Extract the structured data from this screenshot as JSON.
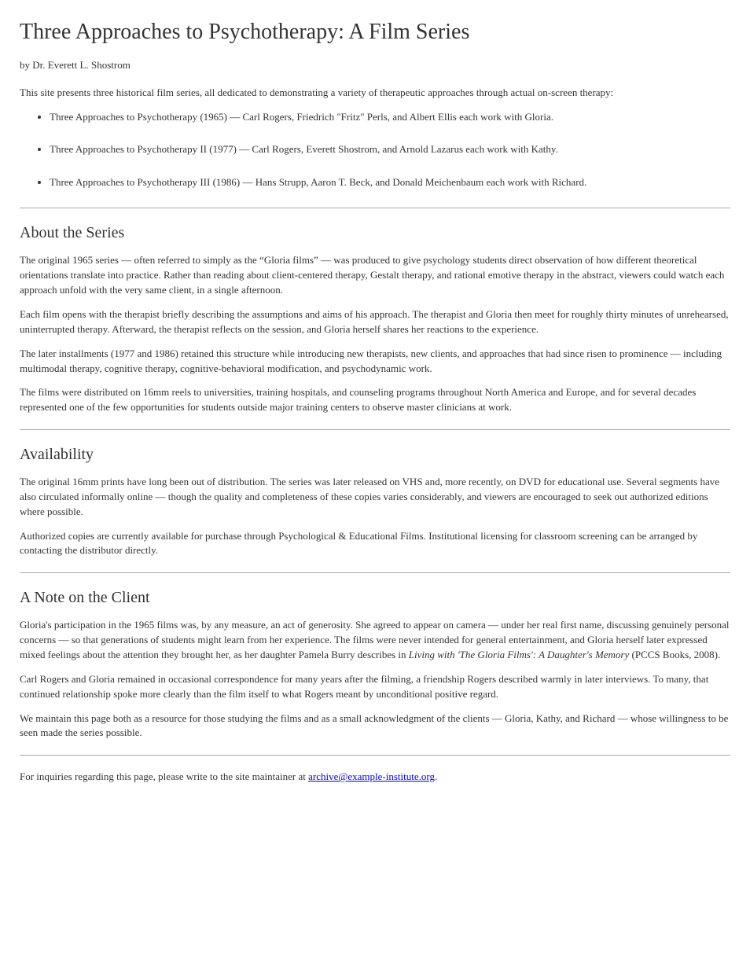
{
  "title": "Three Approaches to Psychotherapy: A Film Series",
  "author": "by Dr. Everett L. Shostrom",
  "intro": "This site presents three historical film series, all dedicated to demonstrating a variety of therapeutic approaches through actual on-screen therapy:",
  "bullets": [
    "Three Approaches to Psychotherapy (1965) — Carl Rogers, Friedrich \"Fritz\" Perls, and Albert Ellis each work with Gloria.",
    "Three Approaches to Psychotherapy II (1977) — Carl Rogers, Everett Shostrom, and Arnold Lazarus each work with Kathy.",
    "Three Approaches to Psychotherapy III (1986) — Hans Strupp, Aaron T. Beck, and Donald Meichenbaum each work with Richard."
  ],
  "sec1": {
    "heading": "About the Series",
    "p1": "The original 1965 series — often referred to simply as the “Gloria films” — was produced to give psychology students direct observation of how different theoretical orientations translate into practice. Rather than reading about client-centered therapy, Gestalt therapy, and rational emotive therapy in the abstract, viewers could watch each approach unfold with the very same client, in a single afternoon.",
    "p2": "Each film opens with the therapist briefly describing the assumptions and aims of his approach. The therapist and Gloria then meet for roughly thirty minutes of unrehearsed, uninterrupted therapy. Afterward, the therapist reflects on the session, and Gloria herself shares her reactions to the experience.",
    "p3": "The later installments (1977 and 1986) retained this structure while introducing new therapists, new clients, and approaches that had since risen to prominence — including multimodal therapy, cognitive therapy, cognitive-behavioral modification, and psychodynamic work.",
    "p4": "The films were distributed on 16mm reels to universities, training hospitals, and counseling programs throughout North America and Europe, and for several decades represented one of the few opportunities for students outside major training centers to observe master clinicians at work."
  },
  "sec2": {
    "heading": "Availability",
    "p1": "The original 16mm prints have long been out of distribution. The series was later released on VHS and, more recently, on DVD for educational use. Several segments have also circulated informally online — though the quality and completeness of these copies varies considerably, and viewers are encouraged to seek out authorized editions where possible.",
    "p2": "Authorized copies are currently available for purchase through Psychological & Educational Films. Institutional licensing for classroom screening can be arranged by contacting the distributor directly."
  },
  "sec3": {
    "heading": "A Note on the Client",
    "p1_part1": "Gloria's participation in the 1965 films was, by any measure, an act of generosity. She agreed to appear on camera — under her real first name, discussing genuinely personal concerns — so that generations of students might learn from her experience. The films were never intended for general entertainment, and Gloria herself later expressed mixed feelings about the attention they brought her, as her daughter Pamela Burry describes in ",
    "p1_em": "Living with 'The Gloria Films': A Daughter's Memory",
    "p1_part2": " (PCCS Books, 2008).",
    "p2": "Carl Rogers and Gloria remained in occasional correspondence for many years after the filming, a friendship Rogers described warmly in later interviews. To many, that continued relationship spoke more clearly than the film itself to what Rogers meant by unconditional positive regard.",
    "p3": "We maintain this page both as a resource for those studying the films and as a small acknowledgment of the clients — Gloria, Kathy, and Richard — whose willingness to be seen made the series possible."
  },
  "footer": {
    "text": "For inquiries regarding this page, please write to the site maintainer at ",
    "link_text": "archive@example-institute.org",
    "link_href": "mailto:archive@example-institute.org",
    "suffix": "."
  }
}
